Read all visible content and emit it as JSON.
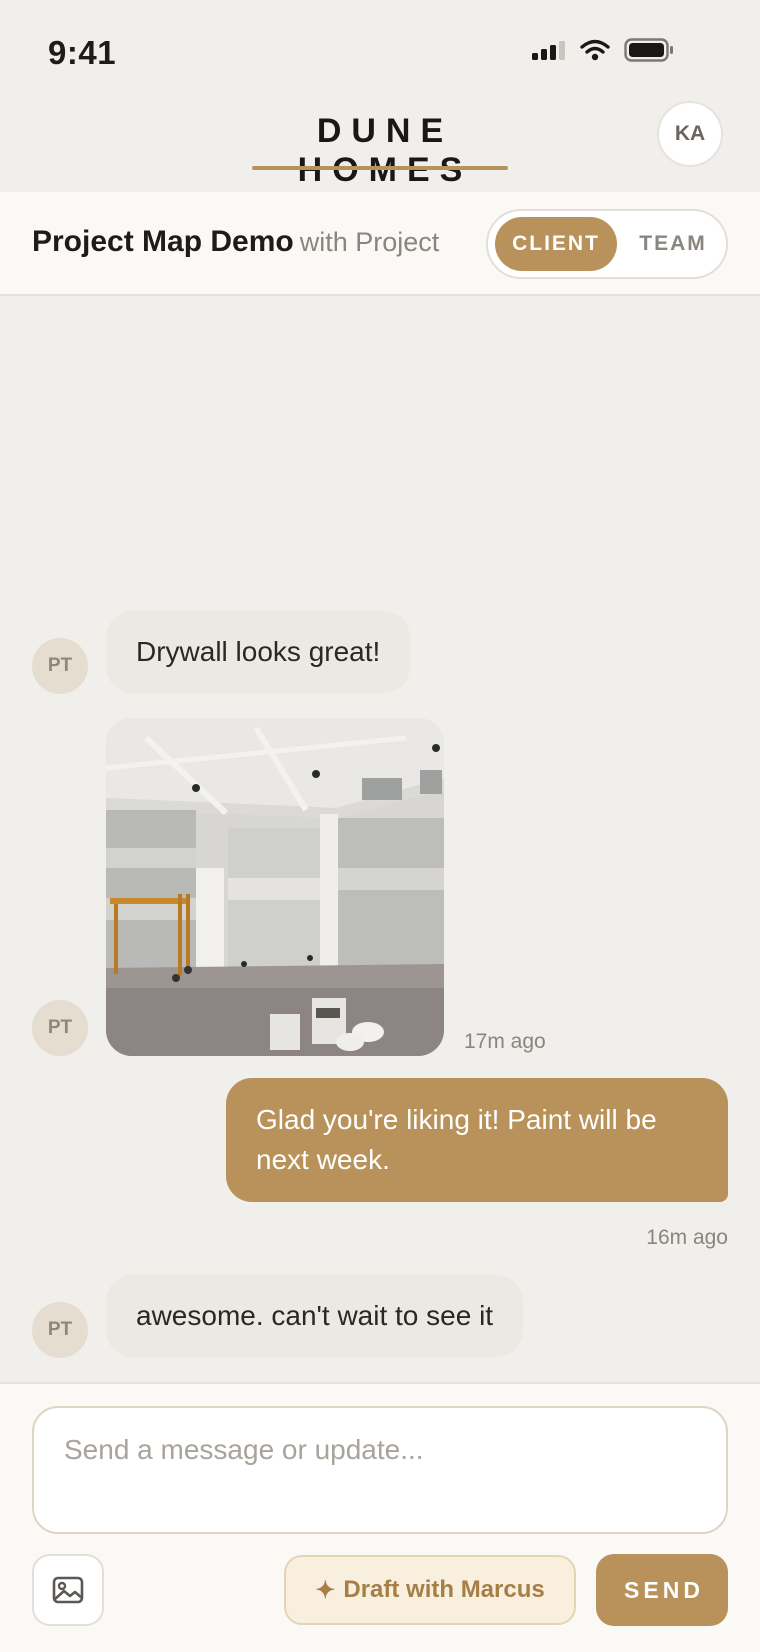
{
  "status_bar": {
    "time": "9:41",
    "icons": [
      "cellular-signal-icon",
      "wifi-icon",
      "battery-icon"
    ]
  },
  "header": {
    "brand": "DUNE HOMES",
    "user_initials": "KA"
  },
  "project": {
    "title": "Project Map Demo",
    "subtitle": "with Project",
    "view_toggle": {
      "options": [
        "CLIENT",
        "TEAM"
      ],
      "selected": "CLIENT"
    }
  },
  "messages": [
    {
      "sender": "PT",
      "direction": "incoming",
      "type": "text",
      "text": "Drywall looks great!"
    },
    {
      "sender": "PT",
      "direction": "incoming",
      "type": "image",
      "timestamp": "17m ago"
    },
    {
      "direction": "outgoing",
      "type": "text",
      "text": "Glad you're liking it! Paint will be next week.",
      "timestamp": "16m ago"
    },
    {
      "sender": "PT",
      "direction": "incoming",
      "type": "text",
      "text": "awesome. can't wait to see it"
    }
  ],
  "composer": {
    "placeholder": "Send a message or update...",
    "value": "",
    "attach_icon": "image-icon",
    "draft_icon": "sparkle-icon",
    "draft_glyph": "✦",
    "draft_label": "Draft with Marcus",
    "send_label": "SEND"
  },
  "colors": {
    "accent": "#b8925a",
    "background": "#f1efeb",
    "incoming_bubble": "#ece9e2",
    "avatar_bg": "#e4ddd0"
  }
}
